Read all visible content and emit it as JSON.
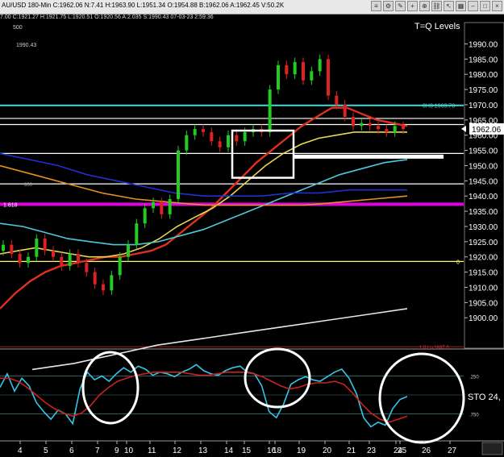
{
  "window": {
    "symbol_line": "AU/USD 180-Min C:1962.06 N:7.41 H:1963.90 L:1951.34 O:1954.88 B:1962.06 A:1962.45 V:50.2K",
    "ohlc_line2": "7.00 C:1921.27 H:1921.75 L:1920.51 O:1920.56 A:2.035 S:1990.43 07-03-23 2:59:36"
  },
  "header_labels": {
    "top_left_value": "500",
    "level_value": "1990.43",
    "title_text": "T=Q Levels",
    "ob_label": "0H3 1969.78",
    "fib_label": "1.618",
    "level_zero": "0",
    "bottom_right_label": "1.0 Lo 1897.0",
    "mid_left_label": "800"
  },
  "current_price": "1962.06",
  "chart_data": [
    {
      "type": "line",
      "ylim": [
        1890,
        1997
      ],
      "y_ticks": [
        "1990.00",
        "1985.00",
        "1980.00",
        "1975.00",
        "1970.00",
        "1965.00",
        "1960.00",
        "1955.00",
        "1950.00",
        "1945.00",
        "1940.00",
        "1935.00",
        "1930.00",
        "1925.00",
        "1920.00",
        "1915.00",
        "1910.00",
        "1905.00",
        "1900.00"
      ],
      "x_ticks": [
        "4",
        "5",
        "6",
        "7",
        "9",
        "10",
        "11",
        "12",
        "13",
        "14",
        "15",
        "16",
        "18",
        "19",
        "20",
        "21",
        "23",
        "24",
        "25",
        "26",
        "27"
      ],
      "horizontal_levels": [
        {
          "value": 1969.8,
          "color": "#4fd5d5"
        },
        {
          "value": 1965.5,
          "color": "#ffffff"
        },
        {
          "value": 1963.5,
          "color": "#ffffff"
        },
        {
          "value": 1954.0,
          "color": "#ffffff"
        },
        {
          "value": 1944.0,
          "color": "#ffffff"
        },
        {
          "value": 1937.3,
          "color": "#e000e0"
        },
        {
          "value": 1918.5,
          "color": "#ffff66"
        }
      ],
      "price_close": [
        1924,
        1921,
        1918,
        1920,
        1926,
        1922,
        1920,
        1917,
        1921,
        1918,
        1915,
        1911,
        1909,
        1914,
        1920,
        1924,
        1931,
        1936,
        1938,
        1934,
        1939,
        1955,
        1960,
        1962,
        1961,
        1958,
        1956,
        1960,
        1958,
        1961,
        1962,
        1961,
        1975,
        1983,
        1980,
        1984,
        1978,
        1981,
        1985,
        1973,
        1970,
        1966,
        1963,
        1964,
        1963,
        1962,
        1961,
        1963,
        1962
      ],
      "series": [
        {
          "name": "ema-red",
          "color": "#e0301e",
          "values": [
            1903,
            1908,
            1912,
            1915,
            1917,
            1918,
            1919,
            1920,
            1920,
            1921,
            1922,
            1924,
            1928,
            1932,
            1936,
            1941,
            1946,
            1951,
            1955,
            1959,
            1963,
            1966,
            1969,
            1969,
            1967,
            1965,
            1964,
            1963
          ]
        },
        {
          "name": "ema-yellow",
          "color": "#e8d850",
          "values": [
            1921,
            1922,
            1923,
            1922,
            1921,
            1920,
            1920,
            1921,
            1923,
            1926,
            1930,
            1933,
            1936,
            1940,
            1945,
            1950,
            1954,
            1957,
            1959,
            1960,
            1961,
            1961,
            1961,
            1961
          ]
        },
        {
          "name": "ema-cyan",
          "color": "#4fc8d8",
          "values": [
            1931,
            1930,
            1928,
            1926,
            1925,
            1924,
            1924,
            1925,
            1927,
            1929,
            1932,
            1935,
            1938,
            1941,
            1944,
            1947,
            1949,
            1951,
            1952
          ]
        },
        {
          "name": "ma-blue",
          "color": "#2030d0",
          "values": [
            1954,
            1952,
            1950,
            1947,
            1945,
            1943,
            1941,
            1940,
            1940,
            1940,
            1941,
            1941,
            1942,
            1942,
            1942
          ]
        },
        {
          "name": "ma-orange",
          "color": "#e89020",
          "values": [
            1950,
            1947,
            1944,
            1941,
            1939,
            1938,
            1937,
            1937,
            1937,
            1937,
            1938,
            1939,
            1940
          ]
        },
        {
          "name": "ma-white",
          "color": "#e6e6e6",
          "values": [
            1883,
            1885,
            1888,
            1891,
            1893,
            1895,
            1897,
            1899,
            1901,
            1903
          ]
        }
      ]
    },
    {
      "type": "line",
      "indicator": "STO",
      "label_text": "STO 24,",
      "tick_labels": [
        ".250",
        ".750"
      ],
      "ylim": [
        0,
        100
      ],
      "series": [
        {
          "name": "%K",
          "color": "#33c6e8",
          "values": [
            60,
            78,
            55,
            72,
            62,
            40,
            28,
            18,
            30,
            25,
            12,
            58,
            80,
            70,
            75,
            68,
            78,
            86,
            80,
            88,
            84,
            76,
            80,
            78,
            74,
            80,
            84,
            90,
            82,
            78,
            76,
            82,
            86,
            88,
            80,
            78,
            62,
            28,
            20,
            38,
            64,
            70,
            74,
            70,
            68,
            74,
            80,
            84,
            72,
            52,
            20,
            8,
            14,
            10,
            32,
            44,
            48
          ]
        },
        {
          "name": "%D",
          "color": "#cc2020",
          "values": [
            72,
            72,
            68,
            60,
            50,
            40,
            32,
            26,
            22,
            26,
            36,
            50,
            60,
            68,
            72,
            76,
            78,
            80,
            80,
            80,
            80,
            78,
            76,
            76,
            78,
            80,
            80,
            80,
            78,
            74,
            68,
            62,
            58,
            60,
            64,
            66,
            66,
            68,
            64,
            52,
            38,
            26,
            18,
            14,
            18,
            22
          ]
        }
      ]
    }
  ]
}
